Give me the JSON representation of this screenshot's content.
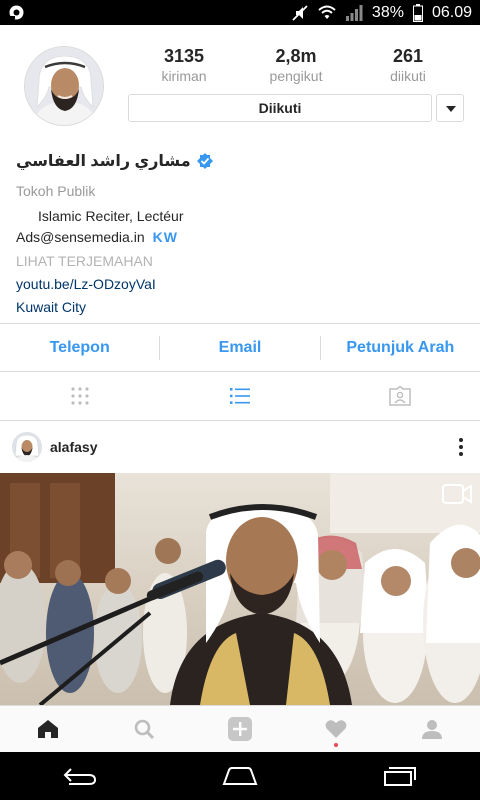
{
  "status_bar": {
    "battery_percent": "38%",
    "time": "06.09",
    "icons": [
      "notification-icon",
      "mute-icon",
      "wifi-icon",
      "signal-icon",
      "battery-icon"
    ]
  },
  "profile": {
    "stats": [
      {
        "value": "3135",
        "label": "kiriman"
      },
      {
        "value": "2,8m",
        "label": "pengikut"
      },
      {
        "value": "261",
        "label": "diikuti"
      }
    ],
    "follow_button": "Diikuti",
    "name": "مشاري راشد العفاسي",
    "verified": true,
    "category": "Tokoh Publik",
    "bio_line_1": "Islamic Reciter, Lectéur",
    "bio_line_2": "Ads@sensemedia.in",
    "bio_flag": "KW",
    "translate_link": "LIHAT TERJEMAHAN",
    "website": "youtu.be/Lz-ODzoyVaI",
    "location": "Kuwait City"
  },
  "contact_buttons": [
    "Telepon",
    "Email",
    "Petunjuk Arah"
  ],
  "view_tabs": [
    "grid-icon",
    "list-icon",
    "tagged-icon"
  ],
  "post": {
    "username": "alafasy",
    "media_type": "video"
  },
  "bottom_nav": [
    "home-icon",
    "search-icon",
    "add-icon",
    "activity-icon",
    "profile-icon"
  ],
  "colors": {
    "accent": "#3897f0",
    "link": "#003569",
    "muted": "#999999",
    "border": "#dbdbdb"
  }
}
